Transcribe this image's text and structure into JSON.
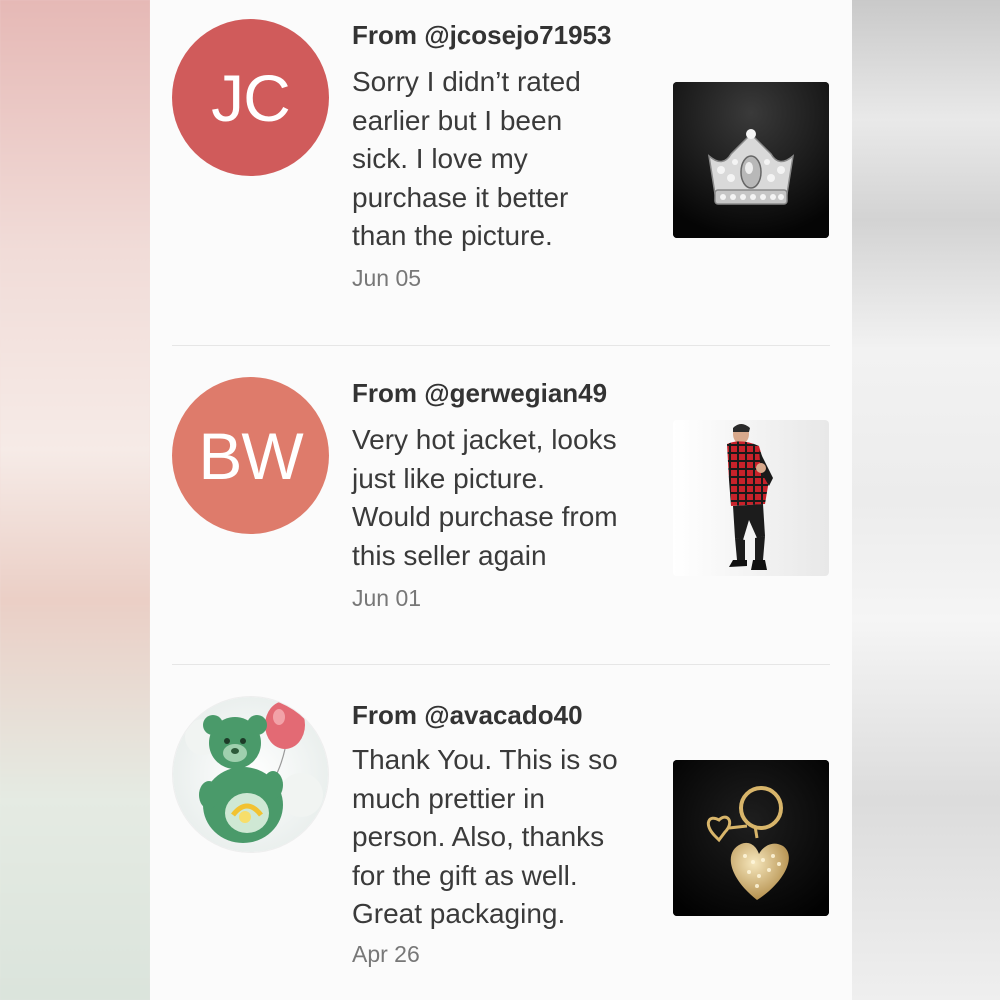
{
  "reviews": [
    {
      "avatar_initials": "JC",
      "avatar_color": "#d05b5b",
      "from": "From @jcosejo71953",
      "lines": [
        "Sorry I didn’t rated",
        "earlier but I been",
        "sick. I love my",
        "purchase it better",
        "than the picture."
      ],
      "date": "Jun 05",
      "thumbnail": "crown-brooch-image"
    },
    {
      "avatar_initials": "BW",
      "avatar_color": "#de7b6b",
      "from": "From @gerwegian49",
      "lines": [
        "Very hot jacket, looks",
        "just like picture.",
        "Would purchase from",
        "this seller again"
      ],
      "date": "Jun 01",
      "thumbnail": "plaid-jacket-image"
    },
    {
      "avatar_image": "green-care-bear-avatar",
      "from": "From @avacado40",
      "lines": [
        "Thank You. This is so",
        "much prettier in",
        "person. Also, thanks",
        "for the gift as well.",
        "Great packaging."
      ],
      "date": "Apr 26",
      "thumbnail": "heart-keychain-image"
    }
  ]
}
